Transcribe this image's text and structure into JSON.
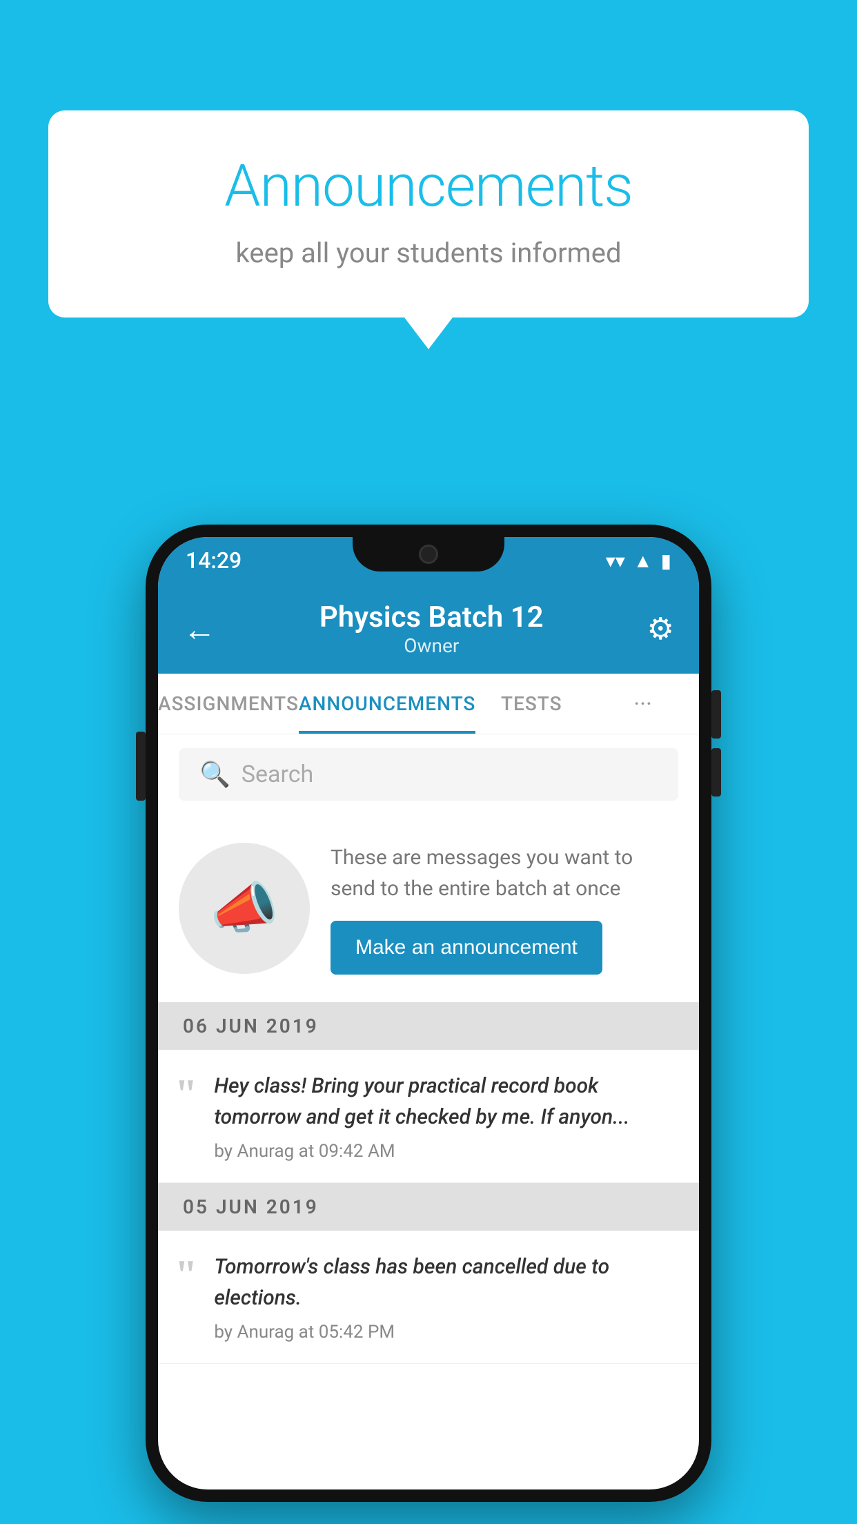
{
  "background_color": "#1ABDE8",
  "speech_bubble": {
    "title": "Announcements",
    "subtitle": "keep all your students informed"
  },
  "phone": {
    "status_bar": {
      "time": "14:29",
      "icons": [
        "wifi",
        "signal",
        "battery"
      ]
    },
    "header": {
      "title": "Physics Batch 12",
      "subtitle": "Owner",
      "back_label": "←",
      "gear_label": "⚙"
    },
    "tabs": [
      {
        "label": "ASSIGNMENTS",
        "active": false
      },
      {
        "label": "ANNOUNCEMENTS",
        "active": true
      },
      {
        "label": "TESTS",
        "active": false
      },
      {
        "label": "···",
        "active": false
      }
    ],
    "search": {
      "placeholder": "Search"
    },
    "announcement_prompt": {
      "icon": "📣",
      "description": "These are messages you want to send to the entire batch at once",
      "button_label": "Make an announcement"
    },
    "date_sections": [
      {
        "date": "06  JUN  2019",
        "announcements": [
          {
            "text": "Hey class! Bring your practical record book tomorrow and get it checked by me. If anyon...",
            "author": "by Anurag at 09:42 AM"
          }
        ]
      },
      {
        "date": "05  JUN  2019",
        "announcements": [
          {
            "text": "Tomorrow's class has been cancelled due to elections.",
            "author": "by Anurag at 05:42 PM"
          }
        ]
      }
    ]
  }
}
